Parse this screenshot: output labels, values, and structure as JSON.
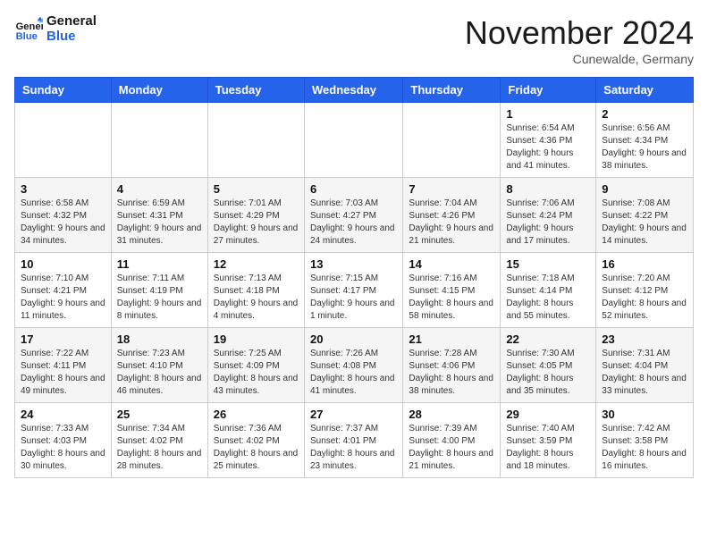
{
  "logo": {
    "line1": "General",
    "line2": "Blue"
  },
  "title": "November 2024",
  "location": "Cunewalde, Germany",
  "weekdays": [
    "Sunday",
    "Monday",
    "Tuesday",
    "Wednesday",
    "Thursday",
    "Friday",
    "Saturday"
  ],
  "weeks": [
    [
      {
        "day": "",
        "info": ""
      },
      {
        "day": "",
        "info": ""
      },
      {
        "day": "",
        "info": ""
      },
      {
        "day": "",
        "info": ""
      },
      {
        "day": "",
        "info": ""
      },
      {
        "day": "1",
        "info": "Sunrise: 6:54 AM\nSunset: 4:36 PM\nDaylight: 9 hours and 41 minutes."
      },
      {
        "day": "2",
        "info": "Sunrise: 6:56 AM\nSunset: 4:34 PM\nDaylight: 9 hours and 38 minutes."
      }
    ],
    [
      {
        "day": "3",
        "info": "Sunrise: 6:58 AM\nSunset: 4:32 PM\nDaylight: 9 hours and 34 minutes."
      },
      {
        "day": "4",
        "info": "Sunrise: 6:59 AM\nSunset: 4:31 PM\nDaylight: 9 hours and 31 minutes."
      },
      {
        "day": "5",
        "info": "Sunrise: 7:01 AM\nSunset: 4:29 PM\nDaylight: 9 hours and 27 minutes."
      },
      {
        "day": "6",
        "info": "Sunrise: 7:03 AM\nSunset: 4:27 PM\nDaylight: 9 hours and 24 minutes."
      },
      {
        "day": "7",
        "info": "Sunrise: 7:04 AM\nSunset: 4:26 PM\nDaylight: 9 hours and 21 minutes."
      },
      {
        "day": "8",
        "info": "Sunrise: 7:06 AM\nSunset: 4:24 PM\nDaylight: 9 hours and 17 minutes."
      },
      {
        "day": "9",
        "info": "Sunrise: 7:08 AM\nSunset: 4:22 PM\nDaylight: 9 hours and 14 minutes."
      }
    ],
    [
      {
        "day": "10",
        "info": "Sunrise: 7:10 AM\nSunset: 4:21 PM\nDaylight: 9 hours and 11 minutes."
      },
      {
        "day": "11",
        "info": "Sunrise: 7:11 AM\nSunset: 4:19 PM\nDaylight: 9 hours and 8 minutes."
      },
      {
        "day": "12",
        "info": "Sunrise: 7:13 AM\nSunset: 4:18 PM\nDaylight: 9 hours and 4 minutes."
      },
      {
        "day": "13",
        "info": "Sunrise: 7:15 AM\nSunset: 4:17 PM\nDaylight: 9 hours and 1 minute."
      },
      {
        "day": "14",
        "info": "Sunrise: 7:16 AM\nSunset: 4:15 PM\nDaylight: 8 hours and 58 minutes."
      },
      {
        "day": "15",
        "info": "Sunrise: 7:18 AM\nSunset: 4:14 PM\nDaylight: 8 hours and 55 minutes."
      },
      {
        "day": "16",
        "info": "Sunrise: 7:20 AM\nSunset: 4:12 PM\nDaylight: 8 hours and 52 minutes."
      }
    ],
    [
      {
        "day": "17",
        "info": "Sunrise: 7:22 AM\nSunset: 4:11 PM\nDaylight: 8 hours and 49 minutes."
      },
      {
        "day": "18",
        "info": "Sunrise: 7:23 AM\nSunset: 4:10 PM\nDaylight: 8 hours and 46 minutes."
      },
      {
        "day": "19",
        "info": "Sunrise: 7:25 AM\nSunset: 4:09 PM\nDaylight: 8 hours and 43 minutes."
      },
      {
        "day": "20",
        "info": "Sunrise: 7:26 AM\nSunset: 4:08 PM\nDaylight: 8 hours and 41 minutes."
      },
      {
        "day": "21",
        "info": "Sunrise: 7:28 AM\nSunset: 4:06 PM\nDaylight: 8 hours and 38 minutes."
      },
      {
        "day": "22",
        "info": "Sunrise: 7:30 AM\nSunset: 4:05 PM\nDaylight: 8 hours and 35 minutes."
      },
      {
        "day": "23",
        "info": "Sunrise: 7:31 AM\nSunset: 4:04 PM\nDaylight: 8 hours and 33 minutes."
      }
    ],
    [
      {
        "day": "24",
        "info": "Sunrise: 7:33 AM\nSunset: 4:03 PM\nDaylight: 8 hours and 30 minutes."
      },
      {
        "day": "25",
        "info": "Sunrise: 7:34 AM\nSunset: 4:02 PM\nDaylight: 8 hours and 28 minutes."
      },
      {
        "day": "26",
        "info": "Sunrise: 7:36 AM\nSunset: 4:02 PM\nDaylight: 8 hours and 25 minutes."
      },
      {
        "day": "27",
        "info": "Sunrise: 7:37 AM\nSunset: 4:01 PM\nDaylight: 8 hours and 23 minutes."
      },
      {
        "day": "28",
        "info": "Sunrise: 7:39 AM\nSunset: 4:00 PM\nDaylight: 8 hours and 21 minutes."
      },
      {
        "day": "29",
        "info": "Sunrise: 7:40 AM\nSunset: 3:59 PM\nDaylight: 8 hours and 18 minutes."
      },
      {
        "day": "30",
        "info": "Sunrise: 7:42 AM\nSunset: 3:58 PM\nDaylight: 8 hours and 16 minutes."
      }
    ]
  ]
}
